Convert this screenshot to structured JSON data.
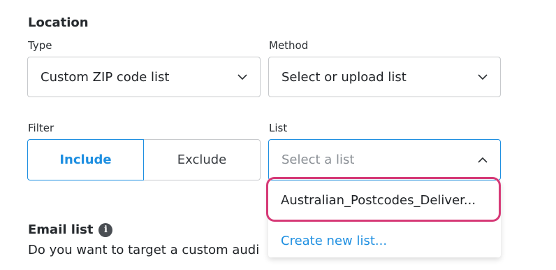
{
  "location": {
    "title": "Location",
    "type_label": "Type",
    "type_value": "Custom ZIP code list",
    "method_label": "Method",
    "method_value": "Select or upload list",
    "filter_label": "Filter",
    "filter_include": "Include",
    "filter_exclude": "Exclude",
    "filter_selected": "Include",
    "list_label": "List",
    "list_placeholder": "Select a list",
    "list_options": [
      "Australian_Postcodes_Deliver..."
    ],
    "create_new_label": "Create new list..."
  },
  "email": {
    "title": "Email list",
    "info_glyph": "i",
    "description": "Do you want to target a custom audi"
  },
  "colors": {
    "accent": "#1e8fe1",
    "highlight": "#d63a77"
  }
}
